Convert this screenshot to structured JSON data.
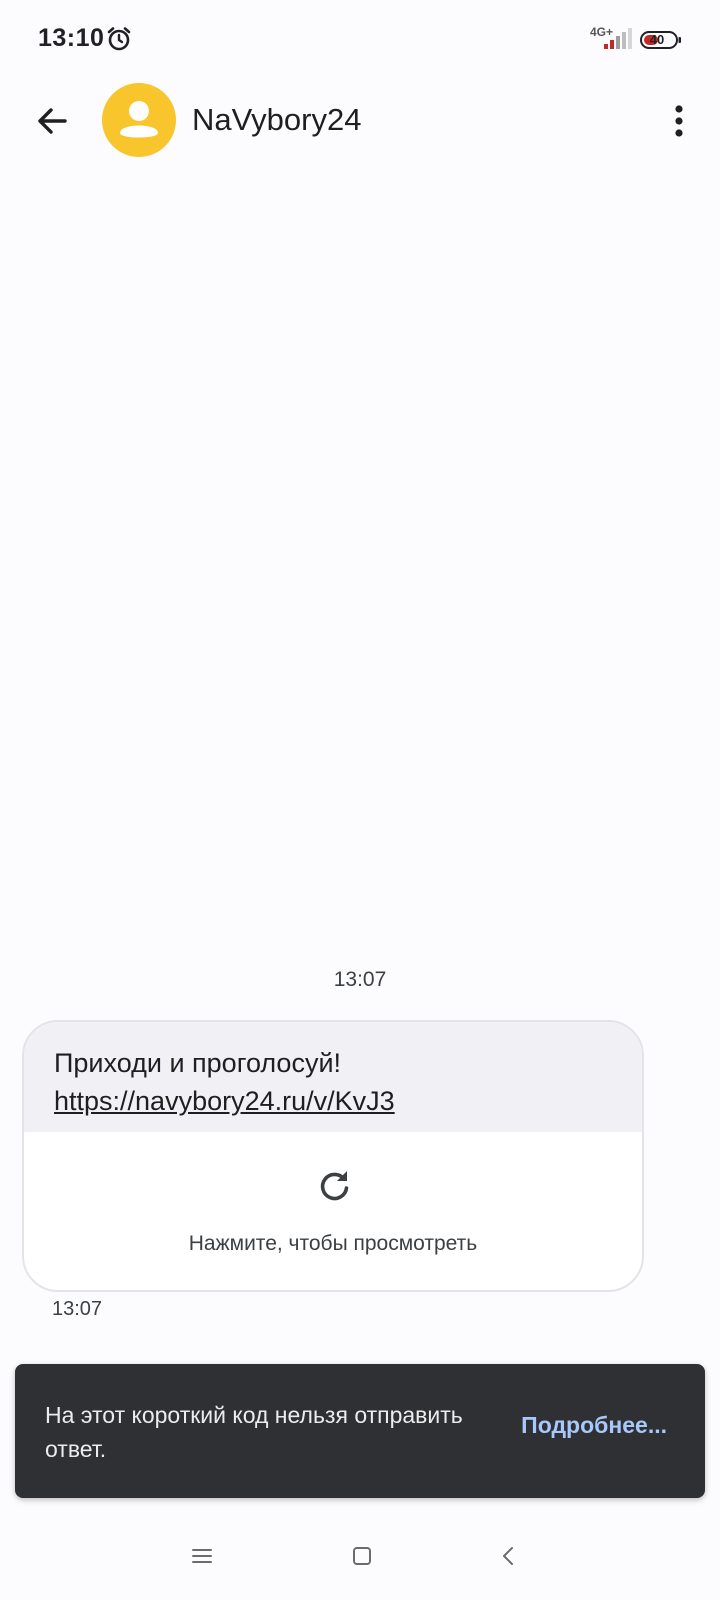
{
  "status_bar": {
    "time": "13:10",
    "network": "4G+",
    "battery": "40",
    "alarm_icon": "alarm-clock-icon",
    "signal_icon": "cell-signal-icon",
    "battery_icon": "battery-icon"
  },
  "app_bar": {
    "contact_name": "NaVybory24",
    "back_icon": "arrow-back-icon",
    "more_icon": "more-vert-icon",
    "avatar_color": "#F8C52C"
  },
  "conversation": {
    "message_time_header": "13:07",
    "message": {
      "text": "Приходи и проголосуй!",
      "link": "https://navybory24.ru/v/KvJ3",
      "preview_prompt": "Нажмите, чтобы просмотреть",
      "preview_icon": "refresh-icon",
      "time": "13:07"
    }
  },
  "snackbar": {
    "text": "На этот короткий код нельзя отправить ответ.",
    "action": "Подробнее..."
  },
  "nav_bar": {
    "recents_icon": "menu-lines-icon",
    "home_icon": "square-home-icon",
    "back_icon": "chevron-back-icon"
  },
  "colors": {
    "background": "#FCFCFE",
    "bubble_background": "#F1F0F5",
    "snackbar_background": "#2E3033",
    "snackbar_action": "#A8C7FA",
    "battery_low_fill": "#C62828"
  }
}
